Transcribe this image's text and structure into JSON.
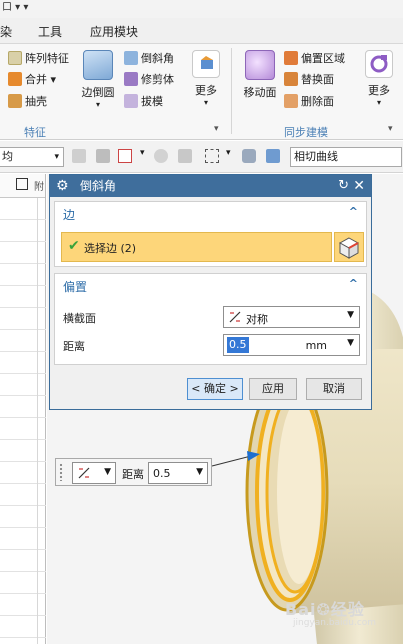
{
  "titlebar": {
    "text": "口 ▾ ▾"
  },
  "menu": {
    "item1": "染",
    "item2": "工具",
    "item3": "应用模块"
  },
  "ribbon": {
    "feature": {
      "array_feature": "阵列特征",
      "merge": "合并",
      "shell": "抽壳",
      "edge_blend": "边倒圆",
      "chamfer": "倒斜角",
      "trim_body": "修剪体",
      "draft": "拔模",
      "more": "更多",
      "group_label": "特征"
    },
    "sync": {
      "move_face": "移动面",
      "offset_region": "偏置区域",
      "replace_face": "替换面",
      "delete_face": "删除面",
      "more": "更多",
      "group_label": "同步建模"
    }
  },
  "toolbar2": {
    "left_select_value": "均",
    "curve_rule_value": "相切曲线"
  },
  "dialog": {
    "title": "倒斜角",
    "edge_section": {
      "title": "边",
      "select_edge_label": "选择边 (2)"
    },
    "offset_section": {
      "title": "偏置",
      "cross_section_label": "横截面",
      "cross_section_value": "对称",
      "distance_label": "距离",
      "distance_value": "0.5",
      "distance_unit": "mm"
    },
    "buttons": {
      "ok": "< 确定 >",
      "apply": "应用",
      "cancel": "取消"
    }
  },
  "float_toolbar": {
    "distance_label": "距离",
    "distance_value": "0.5"
  },
  "left_panel": {
    "header_text": "附"
  },
  "watermark": {
    "text": "Bai❂经验",
    "sub": "jingyan.baidu.com"
  },
  "colors": {
    "dialog_title_bg": "#3f6e9c",
    "section_title": "#2e6da8",
    "selection_highlight": "#fdd67a",
    "part_body": "#e9e1c4",
    "chamfer_edge": "#f0b020"
  }
}
